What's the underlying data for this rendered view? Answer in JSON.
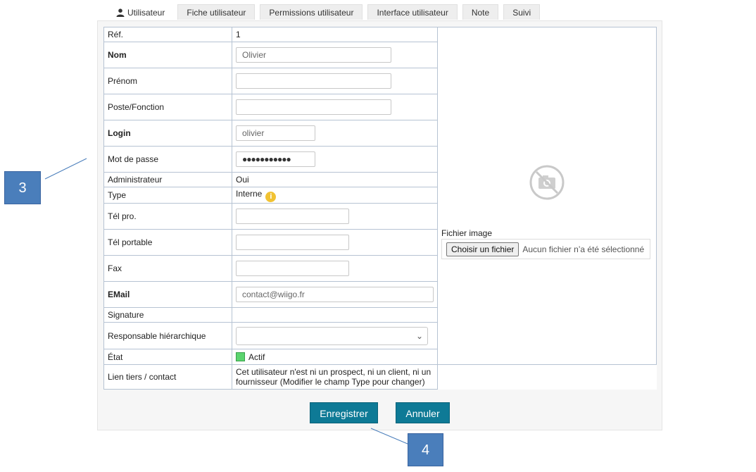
{
  "tabs": [
    {
      "label": "Utilisateur",
      "active": true,
      "icon": "user-icon"
    },
    {
      "label": "Fiche utilisateur"
    },
    {
      "label": "Permissions utilisateur"
    },
    {
      "label": "Interface utilisateur"
    },
    {
      "label": "Note"
    },
    {
      "label": "Suivi"
    }
  ],
  "form": {
    "ref": {
      "label": "Réf.",
      "value": "1"
    },
    "nom": {
      "label": "Nom",
      "value": "Olivier"
    },
    "prenom": {
      "label": "Prénom",
      "value": ""
    },
    "poste": {
      "label": "Poste/Fonction",
      "value": ""
    },
    "login": {
      "label": "Login",
      "value": "olivier"
    },
    "password": {
      "label": "Mot de passe",
      "value": "●●●●●●●●●●●"
    },
    "admin": {
      "label": "Administrateur",
      "value": "Oui"
    },
    "type": {
      "label": "Type",
      "value": "Interne",
      "info_icon": "info-icon"
    },
    "tel_pro": {
      "label": "Tél pro.",
      "value": ""
    },
    "tel_portable": {
      "label": "Tél portable",
      "value": ""
    },
    "fax": {
      "label": "Fax",
      "value": ""
    },
    "email": {
      "label": "EMail",
      "value": "contact@wiigo.fr"
    },
    "signature": {
      "label": "Signature",
      "value": ""
    },
    "responsable": {
      "label": "Responsable hiérarchique",
      "value": ""
    },
    "etat": {
      "label": "État",
      "value": "Actif",
      "status_color": "#5bd46e"
    },
    "lien": {
      "label": "Lien tiers / contact",
      "value": "Cet utilisateur n'est ni un prospect, ni un client, ni un fournisseur (Modifier le champ Type pour changer)"
    }
  },
  "image": {
    "file_label": "Fichier image",
    "choose_button": "Choisir un fichier",
    "file_status": "Aucun fichier n’a été sélectionné",
    "placeholder_icon": "no-photo-icon"
  },
  "actions": {
    "save": "Enregistrer",
    "cancel": "Annuler"
  },
  "callouts": {
    "left": "3",
    "bottom": "4"
  },
  "colors": {
    "button": "#0e7a96",
    "callout": "#4a7ebb",
    "label_bold": "#1c2a5a"
  }
}
